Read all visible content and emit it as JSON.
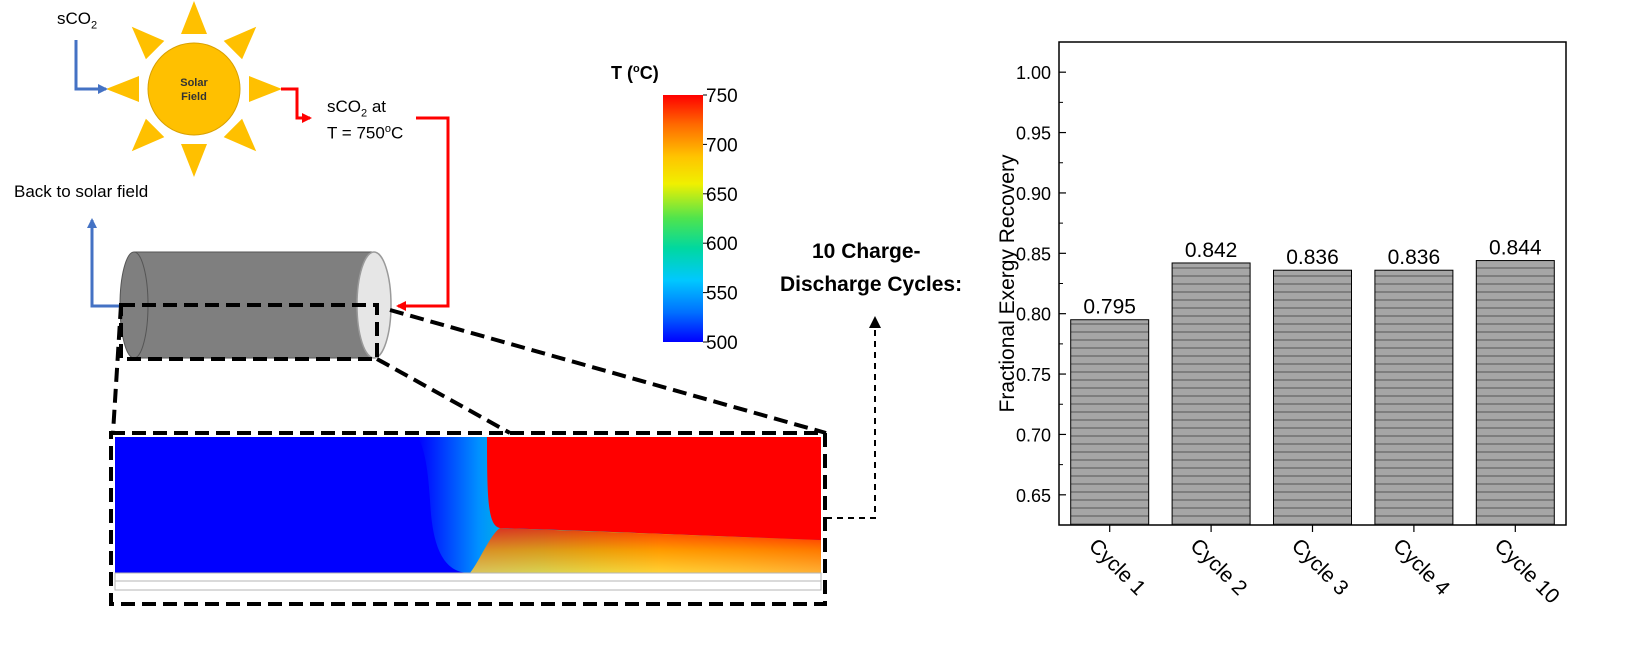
{
  "diagram": {
    "solar": {
      "inlet_label": "sCO",
      "inlet_sub": "2",
      "field_line1": "Solar",
      "field_line2": "Field",
      "outlet_l1a": "sCO",
      "outlet_l1sub": "2",
      "outlet_l1b": " at",
      "outlet_l2a": "T = 750",
      "outlet_l2sup": "o",
      "outlet_l2b": "C",
      "back_label": "Back to solar field"
    },
    "colorbar": {
      "title_a": "T (",
      "title_sup": "o",
      "title_b": "C)",
      "ticks": [
        "750",
        "700",
        "650",
        "600",
        "550",
        "500"
      ]
    },
    "cycles_label_line1": "10 Charge-",
    "cycles_label_line2": "Discharge Cycles:",
    "colors": {
      "sun": "#FFC000",
      "inlet_arrow": "#4472C4",
      "outlet_arrow": "#FF0000",
      "cylinder": "#808080",
      "bar_fill": "#A6A6A6"
    }
  },
  "chart_data": {
    "type": "bar",
    "ylabel": "Fractional Exergy Recovery",
    "categories": [
      "Cycle 1",
      "Cycle 2",
      "Cycle 3",
      "Cycle 4",
      "Cycle 10"
    ],
    "values": [
      0.795,
      0.842,
      0.836,
      0.836,
      0.844
    ],
    "value_labels": [
      "0.795",
      "0.842",
      "0.836",
      "0.836",
      "0.844"
    ],
    "ylim": [
      0.625,
      1.025
    ],
    "yticks": [
      "0.65",
      "0.70",
      "0.75",
      "0.80",
      "0.85",
      "0.90",
      "0.95",
      "1.00"
    ],
    "ytick_values": [
      0.65,
      0.7,
      0.75,
      0.8,
      0.85,
      0.9,
      0.95,
      1.0
    ],
    "bar_pattern": "horizontal-hatch",
    "grid": false
  }
}
